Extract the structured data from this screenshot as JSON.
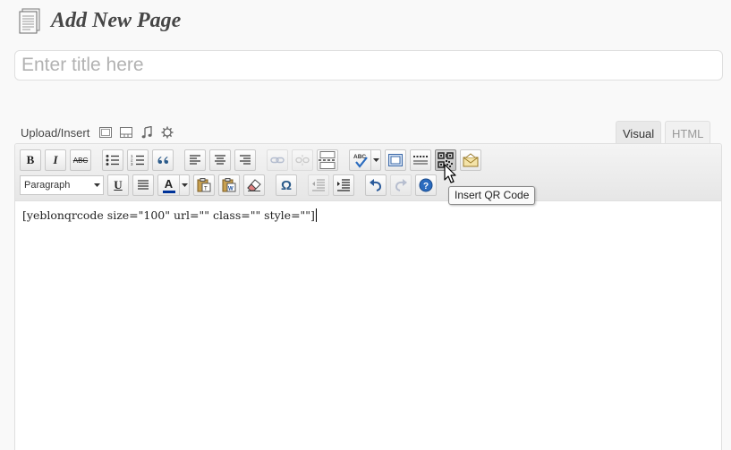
{
  "header": {
    "title": "Add New Page",
    "icon": "pages-icon"
  },
  "title_field": {
    "value": "",
    "placeholder": "Enter title here"
  },
  "media": {
    "label": "Upload/Insert",
    "buttons": [
      {
        "name": "add-image-button",
        "icon": "image-icon"
      },
      {
        "name": "add-video-button",
        "icon": "video-icon"
      },
      {
        "name": "add-audio-button",
        "icon": "audio-icon"
      },
      {
        "name": "add-media-button",
        "icon": "media-icon"
      }
    ]
  },
  "tabs": {
    "visual": "Visual",
    "html": "HTML",
    "active": "visual"
  },
  "toolbar": {
    "bold": "B",
    "italic": "I",
    "strikethrough": "ABC",
    "format_select": "Paragraph",
    "underline": "U",
    "text_color": "A",
    "special_char": "Ω"
  },
  "editor": {
    "content": "[yeblonqrcode size=\"100\" url=\"\" class=\"\" style=\"\"]"
  },
  "tooltip": {
    "text": "Insert QR Code"
  },
  "colors": {
    "text_color_bar": "#003399",
    "page_bg": "#f9f9f9",
    "border": "#dfdfdf"
  }
}
